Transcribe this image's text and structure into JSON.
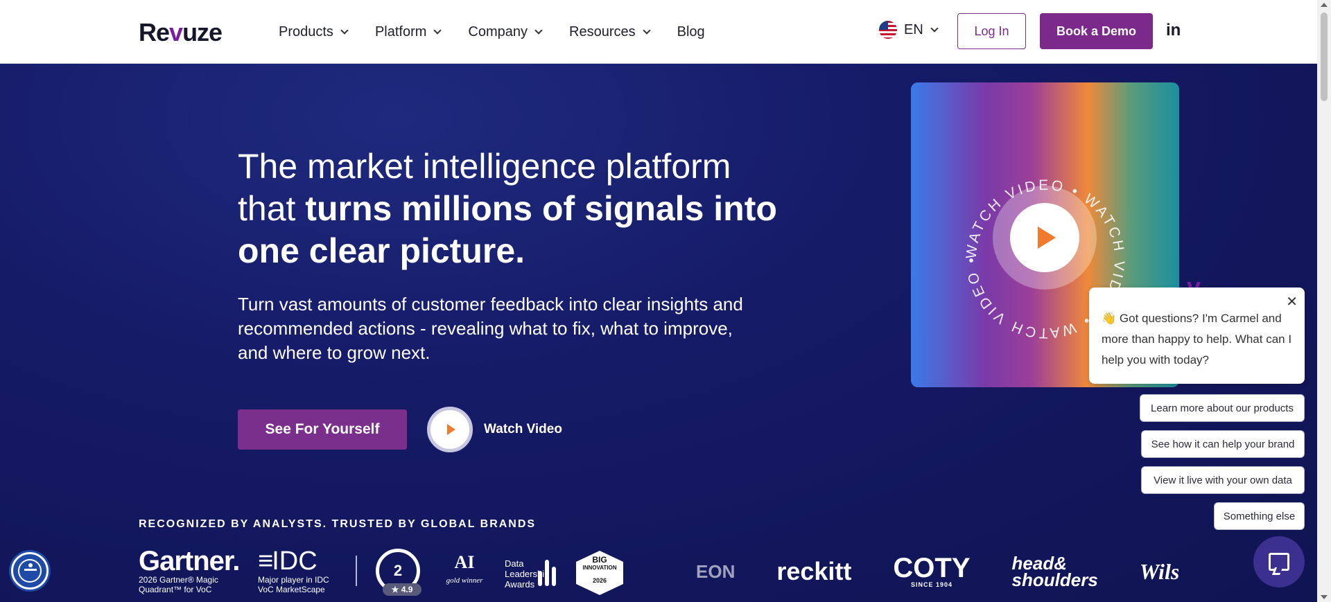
{
  "header": {
    "logo": {
      "pre": "Re",
      "v": "v",
      "post": "uze"
    },
    "nav": [
      {
        "label": "Products",
        "has_dropdown": true
      },
      {
        "label": "Platform",
        "has_dropdown": true
      },
      {
        "label": "Company",
        "has_dropdown": true
      },
      {
        "label": "Resources",
        "has_dropdown": true
      },
      {
        "label": "Blog",
        "has_dropdown": false
      }
    ],
    "language": "EN",
    "login_label": "Log In",
    "demo_label": "Book a Demo",
    "linkedin_label": "in"
  },
  "hero": {
    "headline_regular": "The market intelligence platform that ",
    "headline_bold": "turns millions of signals into one clear picture.",
    "subtext": "Turn vast amounts of customer feedback into clear insights and recommended actions - revealing what to fix, what to improve, and where to grow next.",
    "cta_label": "See For Yourself",
    "watch_label": "Watch Video",
    "video_ring_text": "WATCH VIDEO • WATCH VIDEO • WATCH VIDEO • "
  },
  "chat": {
    "message": "👋 Got questions? I'm Carmel and more than happy to help. What can I help you with today?",
    "close": "✕",
    "avatar": "v",
    "options": [
      "Learn more about our products",
      "See how it can help your brand",
      "View it live with your own data",
      "Something else"
    ]
  },
  "recognition": {
    "label": "RECOGNIZED BY ANALYSTS. TRUSTED BY GLOBAL BRANDS",
    "gartner": {
      "name": "Gartner.",
      "caption_1": "2026 Gartner® Magic",
      "caption_2": "Quadrant™ for VoC"
    },
    "idc": {
      "name": "IDC",
      "caption_1": "Major player in IDC",
      "caption_2": "VoC MarketScape"
    },
    "g2": {
      "name": "2",
      "rating": "★ 4.9"
    },
    "ai_award": {
      "name": "AI",
      "caption": "gold winner"
    },
    "dla": {
      "line1": "Data",
      "line2": "Leadership",
      "line3": "Awards"
    },
    "big_innovation": {
      "line1": "BIG",
      "line2": "INNOVATION",
      "year": "2026"
    },
    "brands": [
      {
        "name": "EON"
      },
      {
        "name": "reckitt"
      },
      {
        "name": "COTY",
        "sub": "SINCE 1904"
      },
      {
        "name": "head&",
        "name2": "shoulders"
      },
      {
        "name": "Wilson"
      }
    ]
  },
  "colors": {
    "brand_purple": "#7b2a8b",
    "hero_bg": "#151a66",
    "play_orange": "#f07b2e",
    "chat_launcher": "#3b2f8f",
    "accessibility_blue": "#1f4aa8"
  },
  "icons": {
    "chevron": "chevron-down-icon",
    "play": "play-icon",
    "chat": "chat-icon",
    "accessibility": "accessibility-icon",
    "flag": "us-flag-icon",
    "linkedin": "linkedin-icon"
  }
}
